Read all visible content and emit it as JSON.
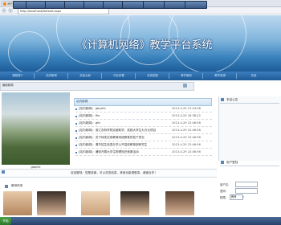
{
  "browser": {
    "tabs": [
      {
        "label": "我的支付宝 － 支付宝"
      },
      {
        "label": "c# 绑定数据 - 腾讯网 - 百度搜索"
      },
      {
        "label": "《计算机网络》教学平台系统"
      }
    ],
    "url": "http://localhost/Default.aspx"
  },
  "banner": {
    "title": "《计算机网络》教学平台系统"
  },
  "nav": {
    "items": [
      "课程简介",
      "站内新闻",
      "实验大纲",
      "作业布置",
      "在线答疑",
      "教学案例",
      "教学资源",
      "实验"
    ]
  },
  "news": {
    "bar_label": "最新新闻",
    "header_label": "站内新闻",
    "photo_caption": "gbqrfxl",
    "rows": [
      {
        "title": "[站内新闻]：gbqrfxl",
        "date": "2013-4-29 21:24:38"
      },
      {
        "title": "[站内新闻]：ffsr",
        "date": "2013-4-29 18:38:22"
      },
      {
        "title": "[站内新闻]：gfd",
        "date": "2013-4-29 22:46:56"
      },
      {
        "title": "[站内新闻]：浙江农林学院实施助学、奖励大学生为万元项目",
        "date": "2013-4-29 22:46:56"
      },
      {
        "title": "[站内新闻]：关于转发实现教育网络教育的若干意见",
        "date": "2013-4-29 22:46:56"
      },
      {
        "title": "[站内新闻]：清华招生信息办学公开招收教育部研究生",
        "date": "2013-4-29 22:46:56"
      },
      {
        "title": "[站内新闻]：通知开展大学生物理知识竞赛活动",
        "date": "2013-4-29 22:46:56"
      }
    ]
  },
  "sidebar": {
    "announce_label": "本站公告",
    "login_label": "用户登陆",
    "username_label": "用户名：",
    "password_label": "密码：",
    "role_label": "权限：",
    "role_value": "教师"
  },
  "welcome": {
    "text": "欢迎登陆：您是游客，可以浏览信息，其他功能请登录，谢谢合作！"
  },
  "teachers": {
    "label": "教师风采"
  },
  "taskbar": {
    "start": "开始",
    "items": [
      "",
      "",
      "",
      "",
      "",
      "",
      "",
      "",
      "",
      ""
    ]
  }
}
